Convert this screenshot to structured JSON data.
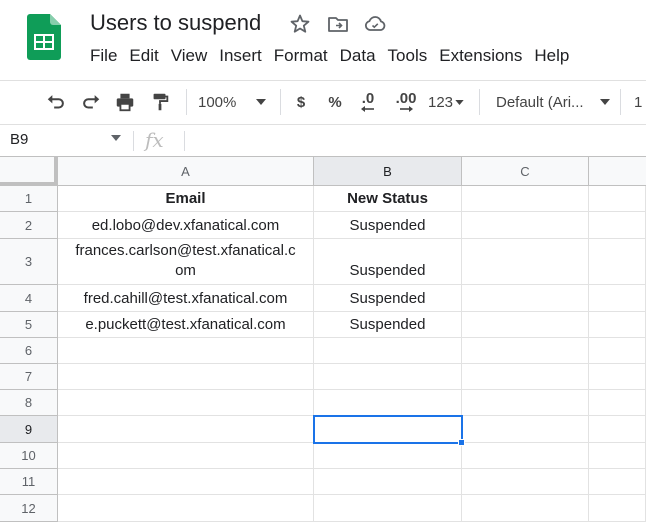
{
  "document": {
    "title": "Users to suspend"
  },
  "menu": [
    "File",
    "Edit",
    "View",
    "Insert",
    "Format",
    "Data",
    "Tools",
    "Extensions",
    "Help"
  ],
  "toolbar": {
    "zoom": "100%",
    "currency": "$",
    "percent": "%",
    "decrease_decimal": ".0",
    "increase_decimal": ".00",
    "more_formats": "123",
    "font": "Default (Ari...",
    "font_size": "1"
  },
  "formula_bar": {
    "name_box": "B9",
    "fx": "fx",
    "value": ""
  },
  "columns": [
    "A",
    "B",
    "C"
  ],
  "rows": [
    "1",
    "2",
    "3",
    "4",
    "5",
    "6",
    "7",
    "8",
    "9",
    "10",
    "11",
    "12"
  ],
  "sheet": {
    "headers": [
      "Email",
      "New Status"
    ],
    "records": [
      {
        "email": "ed.lobo@dev.xfanatical.com",
        "status": "Suspended"
      },
      {
        "email": "frances.carlson@test.xfanatical.c",
        "email_wrap": "om",
        "status": "Suspended"
      },
      {
        "email": "fred.cahill@test.xfanatical.com",
        "status": "Suspended"
      },
      {
        "email": "e.puckett@test.xfanatical.com",
        "status": "Suspended"
      }
    ]
  },
  "selected_cell": "B9",
  "colors": {
    "accent": "#1a73e8",
    "sheets_green": "#0f9d58"
  }
}
